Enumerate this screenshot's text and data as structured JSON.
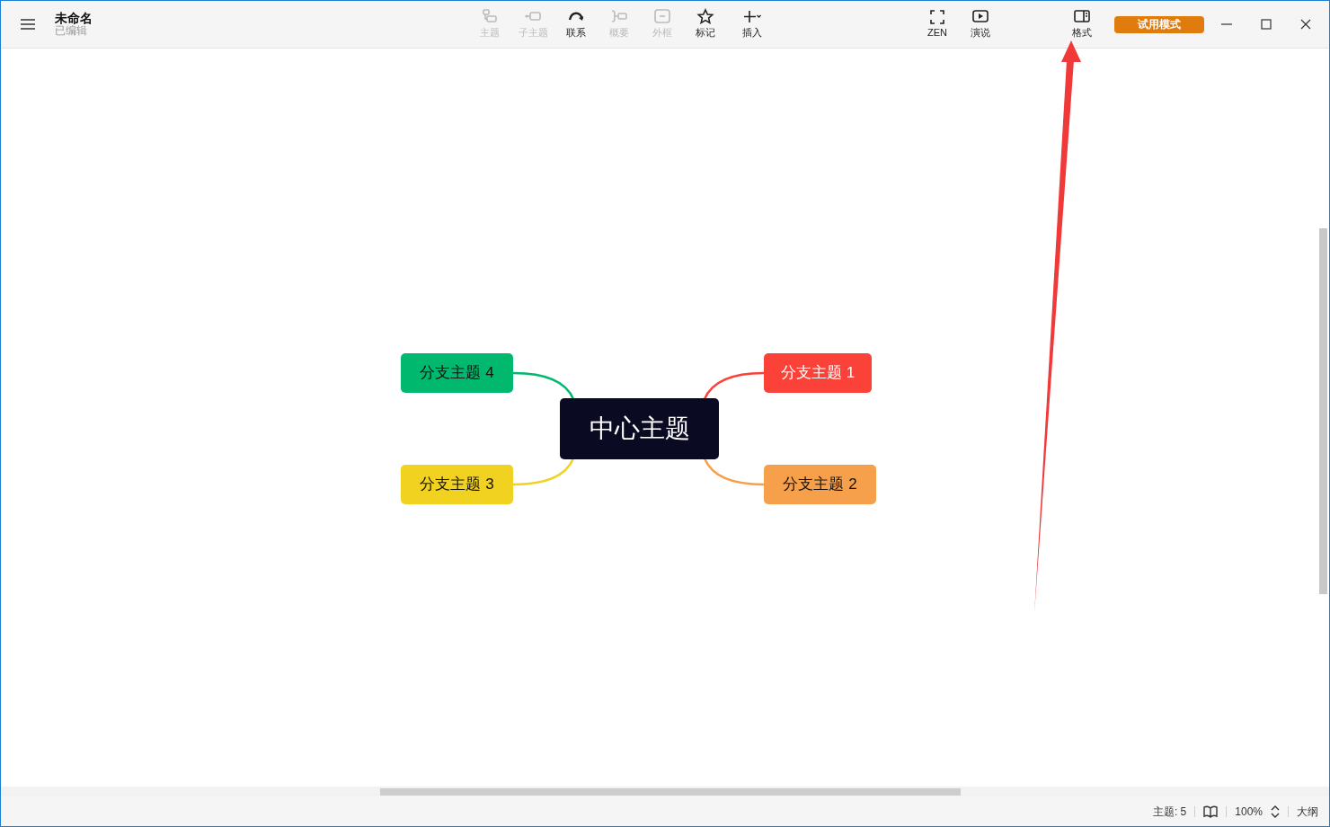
{
  "window": {
    "title": "未命名",
    "subtitle": "已编辑"
  },
  "toolbar": [
    {
      "kind": "topic",
      "label": "主题",
      "disabled": true
    },
    {
      "kind": "subtopic",
      "label": "子主题",
      "disabled": true
    },
    {
      "kind": "relation",
      "label": "联系",
      "disabled": false
    },
    {
      "kind": "summary",
      "label": "概要",
      "disabled": true
    },
    {
      "kind": "boundary",
      "label": "外框",
      "disabled": true
    },
    {
      "kind": "marker",
      "label": "标记",
      "disabled": false
    },
    {
      "kind": "insert",
      "label": "插入",
      "disabled": false
    }
  ],
  "view_tools": [
    {
      "kind": "zen",
      "label": "ZEN"
    },
    {
      "kind": "present",
      "label": "演说"
    }
  ],
  "format_button": {
    "label": "格式"
  },
  "trial_badge": "试用模式",
  "map": {
    "central": {
      "label": "中心主题"
    },
    "branches": [
      {
        "label": "分支主题 4",
        "color": "#00b96f",
        "light_text": false
      },
      {
        "label": "分支主题 1",
        "color": "#fb4238",
        "light_text": true
      },
      {
        "label": "分支主题 3",
        "color": "#f1d220",
        "light_text": false
      },
      {
        "label": "分支主题 2",
        "color": "#f7a04b",
        "light_text": false
      }
    ]
  },
  "status_bar": {
    "topic_count": "主题: 5",
    "zoom": "100%",
    "outline": "大纲"
  },
  "annotation": {
    "kind": "arrow"
  }
}
